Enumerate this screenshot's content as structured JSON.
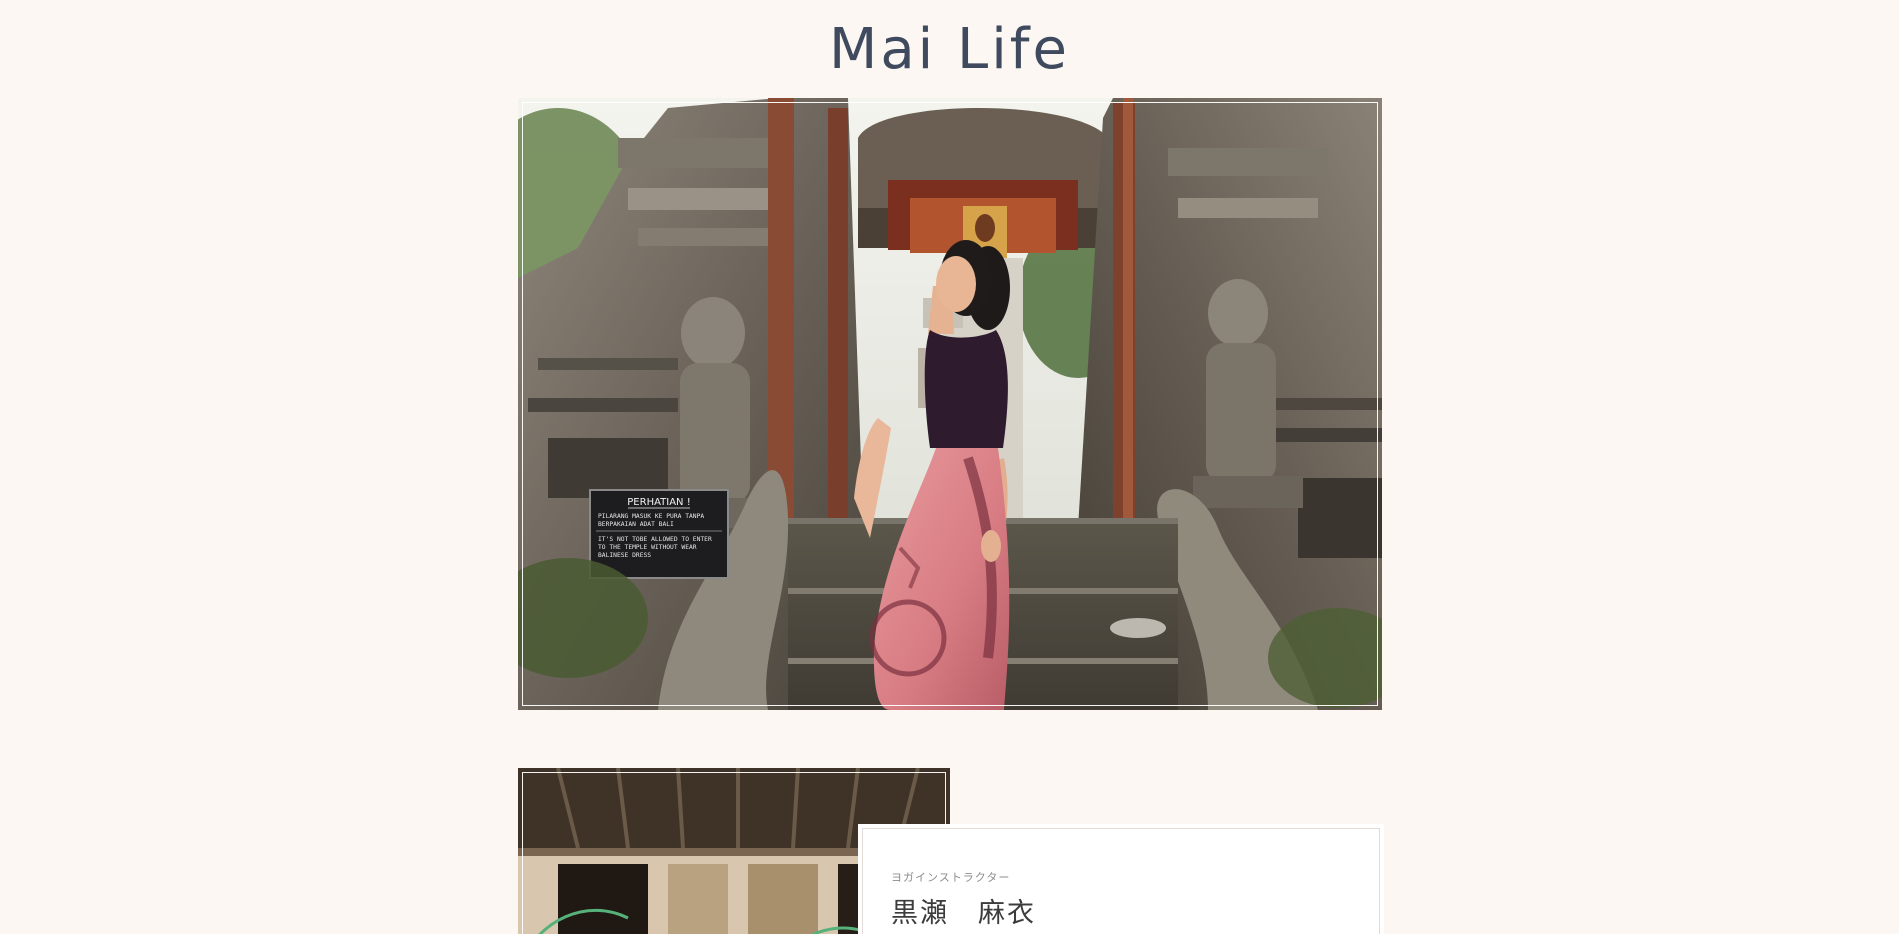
{
  "site": {
    "title": "Mai Life"
  },
  "hero": {
    "sign": {
      "heading": "PERHATIAN !",
      "line1": "PILARANG MASUK KE PURA TANPA",
      "line2": "BERPAKAIAN ADAT BALI",
      "line3": "IT'S NOT TOBE ALLOWED TO ENTER",
      "line4": "TO THE TEMPLE WITHOUT WEAR",
      "line5": "BALINESE DRESS"
    }
  },
  "profile": {
    "role": "ヨガインストラクター",
    "name": "黒瀬　麻衣"
  },
  "colors": {
    "background": "#fdf7f3",
    "title": "#3f4a5e",
    "card": "#ffffff"
  }
}
